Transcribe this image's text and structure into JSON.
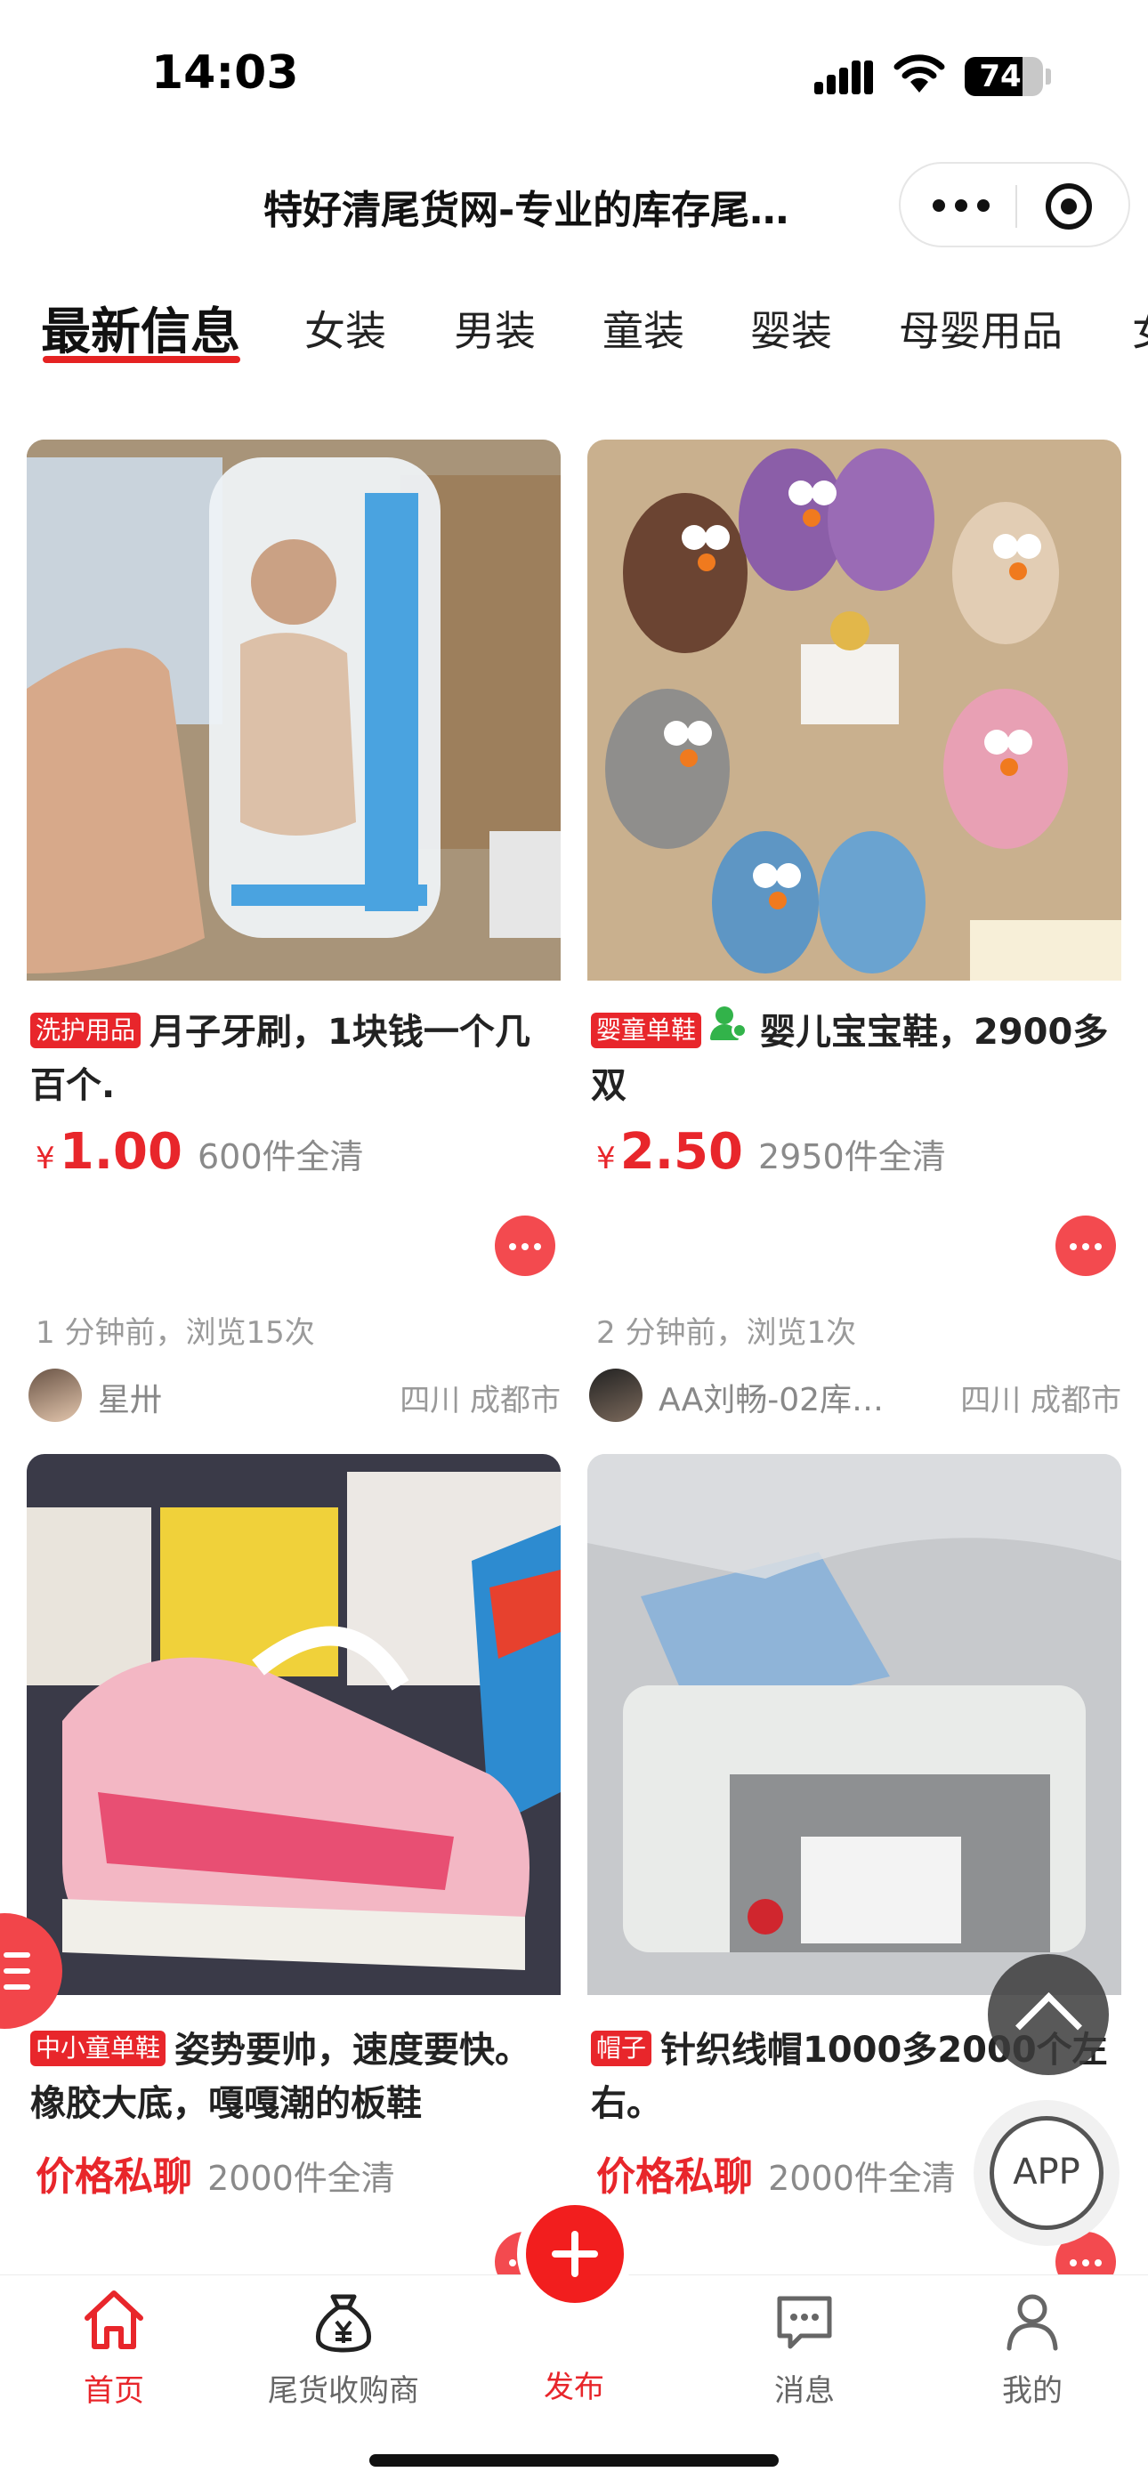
{
  "status_bar": {
    "time": "14:03",
    "battery": "74",
    "battery_level": 0.74
  },
  "header": {
    "title": "特好清尾货网-专业的库存尾…"
  },
  "capsule": {
    "more_icon": "more-dots-icon",
    "close_icon": "target-icon"
  },
  "tabs": [
    {
      "label": "最新信息",
      "active": true
    },
    {
      "label": "女装"
    },
    {
      "label": "男装"
    },
    {
      "label": "童装"
    },
    {
      "label": "婴装"
    },
    {
      "label": "母婴用品"
    },
    {
      "label": "女"
    }
  ],
  "listings": [
    {
      "tag": "洗护用品",
      "title": "月子牙刷，1块钱一个几百个.",
      "currency": "¥",
      "price": "1.00",
      "quantity": "600件全清",
      "meta": "1 分钟前，浏览15次",
      "seller": "星卅",
      "location": "四川 成都市"
    },
    {
      "tag": "婴童单鞋",
      "title": "婴儿宝宝鞋，2900多双",
      "currency": "¥",
      "price": "2.50",
      "quantity": "2950件全清",
      "meta": "2 分钟前，浏览1次",
      "seller": "AA刘畅-02库…",
      "location": "四川 成都市"
    },
    {
      "tag": "中小童单鞋",
      "title": "姿势要帅，速度要快。橡胶大底，嘎嘎潮的板鞋",
      "price_text": "价格私聊",
      "quantity": "2000件全清"
    },
    {
      "tag": "帽子",
      "title": "针织线帽1000多2000个左右。",
      "price_text": "价格私聊",
      "quantity": "2000件全清"
    }
  ],
  "floating": {
    "app_label": "APP"
  },
  "bottom_nav": [
    {
      "label": "首页",
      "icon": "home-icon",
      "active": true
    },
    {
      "label": "尾货收购商",
      "icon": "money-bag-icon"
    },
    {
      "label": "发布",
      "icon": "plus-icon"
    },
    {
      "label": "消息",
      "icon": "message-icon"
    },
    {
      "label": "我的",
      "icon": "user-icon"
    }
  ],
  "colors": {
    "accent": "#e8262b",
    "tab_underline": "#e52222",
    "muted": "#999999"
  }
}
